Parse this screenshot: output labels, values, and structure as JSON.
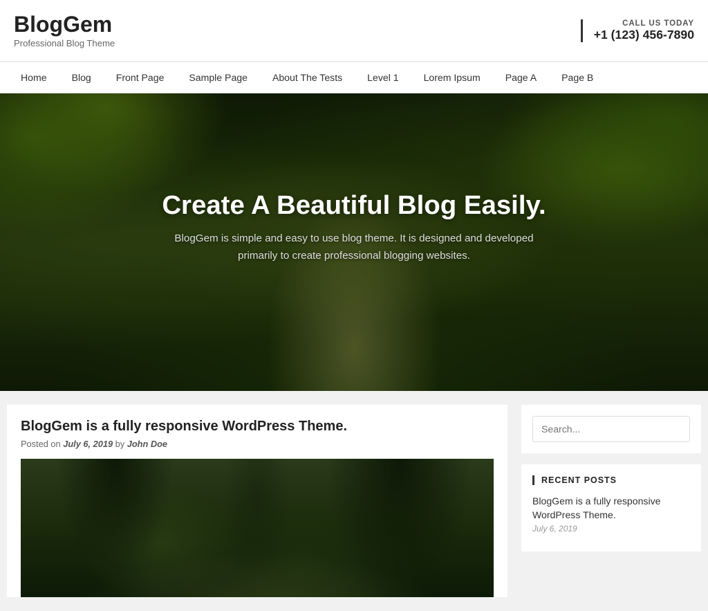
{
  "header": {
    "site_title": "BlogGem",
    "site_tagline": "Professional Blog Theme",
    "call_label": "CALL US TODAY",
    "phone": "+1 (123) 456-7890"
  },
  "nav": {
    "items": [
      {
        "label": "Home",
        "href": "#"
      },
      {
        "label": "Blog",
        "href": "#"
      },
      {
        "label": "Front Page",
        "href": "#"
      },
      {
        "label": "Sample Page",
        "href": "#"
      },
      {
        "label": "About The Tests",
        "href": "#"
      },
      {
        "label": "Level 1",
        "href": "#"
      },
      {
        "label": "Lorem Ipsum",
        "href": "#"
      },
      {
        "label": "Page A",
        "href": "#"
      },
      {
        "label": "Page B",
        "href": "#"
      }
    ]
  },
  "hero": {
    "title": "Create A Beautiful Blog Easily.",
    "subtitle": "BlogGem is simple and easy to use blog theme. It is designed and developed primarily to create professional blogging websites."
  },
  "post": {
    "title": "BlogGem is a fully responsive WordPress Theme.",
    "meta_prefix": "Posted on",
    "date": "July 6, 2019",
    "meta_by": "by",
    "author": "John Doe"
  },
  "sidebar": {
    "search_placeholder": "Search...",
    "recent_posts_title": "RECENT POSTS",
    "recent_posts": [
      {
        "title": "BlogGem is a fully responsive WordPress Theme.",
        "date": "July 6, 2019"
      }
    ]
  },
  "search_label": "Search ."
}
